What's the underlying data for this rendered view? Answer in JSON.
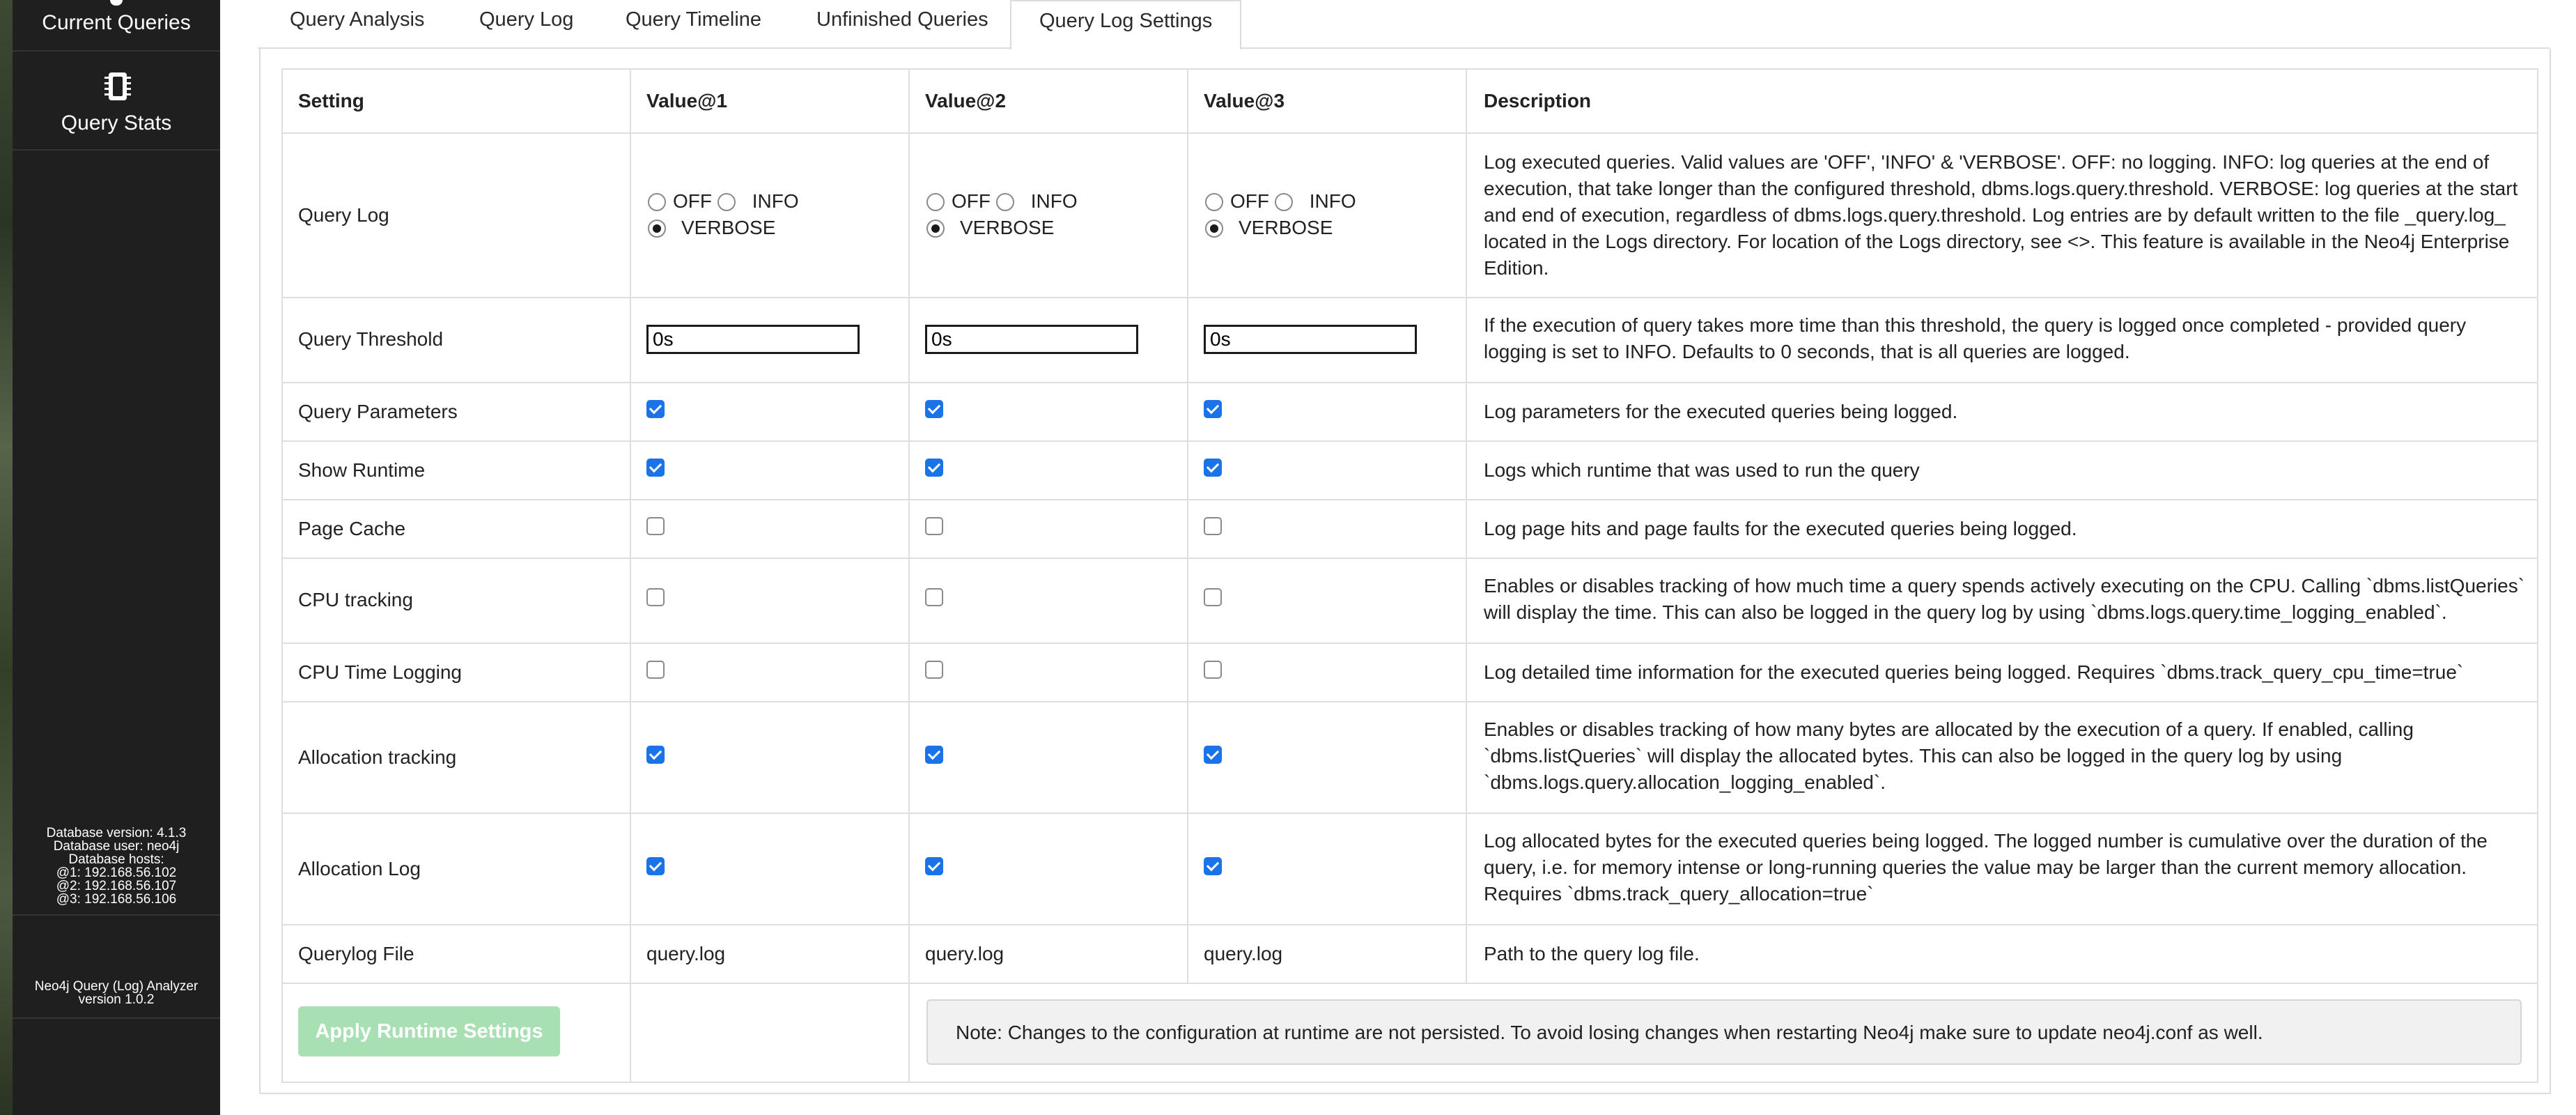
{
  "sidebar": {
    "current_queries": "Current Queries",
    "query_stats": "Query Stats",
    "db_info": [
      "Database version: 4.1.3",
      "Database user: neo4j",
      "Database hosts:",
      "@1: 192.168.56.102",
      "@2: 192.168.56.107",
      "@3: 192.168.56.106"
    ],
    "app_name": "Neo4j Query (Log) Analyzer",
    "app_version": "version 1.0.2"
  },
  "tabs": [
    {
      "label": "Query Analysis",
      "active": false
    },
    {
      "label": "Query Log",
      "active": false
    },
    {
      "label": "Query Timeline",
      "active": false
    },
    {
      "label": "Unfinished Queries",
      "active": false
    },
    {
      "label": "Query Log Settings",
      "active": true
    }
  ],
  "table": {
    "headers": [
      "Setting",
      "Value@1",
      "Value@2",
      "Value@3",
      "Description"
    ],
    "radio_options": [
      "OFF",
      "INFO",
      "VERBOSE"
    ],
    "rows": [
      {
        "setting": "Query Log",
        "type": "radio",
        "values": [
          "VERBOSE",
          "VERBOSE",
          "VERBOSE"
        ],
        "description": "Log executed queries. Valid values are 'OFF', 'INFO' & 'VERBOSE'. OFF: no logging. INFO: log queries at the end of execution, that take longer than the configured threshold, dbms.logs.query.threshold. VERBOSE: log queries at the start and end of execution, regardless of dbms.logs.query.threshold. Log entries are by default written to the file _query.log_ located in the Logs directory. For location of the Logs directory, see <>. This feature is available in the Neo4j Enterprise Edition."
      },
      {
        "setting": "Query Threshold",
        "type": "text",
        "values": [
          "0s",
          "0s",
          "0s"
        ],
        "description": "If the execution of query takes more time than this threshold, the query is logged once completed - provided query logging is set to INFO. Defaults to 0 seconds, that is all queries are logged."
      },
      {
        "setting": "Query Parameters",
        "type": "checkbox",
        "values": [
          true,
          true,
          true
        ],
        "description": "Log parameters for the executed queries being logged."
      },
      {
        "setting": "Show Runtime",
        "type": "checkbox",
        "values": [
          true,
          true,
          true
        ],
        "description": "Logs which runtime that was used to run the query"
      },
      {
        "setting": "Page Cache",
        "type": "checkbox",
        "values": [
          false,
          false,
          false
        ],
        "description": "Log page hits and page faults for the executed queries being logged."
      },
      {
        "setting": "CPU tracking",
        "type": "checkbox",
        "values": [
          false,
          false,
          false
        ],
        "description": "Enables or disables tracking of how much time a query spends actively executing on the CPU. Calling `dbms.listQueries` will display the time. This can also be logged in the query log by using `dbms.logs.query.time_logging_enabled`."
      },
      {
        "setting": "CPU Time Logging",
        "type": "checkbox",
        "values": [
          false,
          false,
          false
        ],
        "description": "Log detailed time information for the executed queries being logged. Requires `dbms.track_query_cpu_time=true`"
      },
      {
        "setting": "Allocation tracking",
        "type": "checkbox",
        "values": [
          true,
          true,
          true
        ],
        "description": "Enables or disables tracking of how many bytes are allocated by the execution of a query. If enabled, calling `dbms.listQueries` will display the allocated bytes. This can also be logged in the query log by using `dbms.logs.query.allocation_logging_enabled`."
      },
      {
        "setting": "Allocation Log",
        "type": "checkbox",
        "values": [
          true,
          true,
          true
        ],
        "description": "Log allocated bytes for the executed queries being logged. The logged number is cumulative over the duration of the query, i.e. for memory intense or long-running queries the value may be larger than the current memory allocation. Requires `dbms.track_query_allocation=true`"
      },
      {
        "setting": "Querylog File",
        "type": "static",
        "values": [
          "query.log",
          "query.log",
          "query.log"
        ],
        "description": "Path to the query log file."
      }
    ]
  },
  "apply_button": "Apply Runtime Settings",
  "note": "Note: Changes to the configuration at runtime are not persisted. To avoid losing changes when restarting Neo4j make sure to update neo4j.conf as well.",
  "colors": {
    "sidebar_bg": "#1f1f1f",
    "checkbox_checked": "#1a73e8",
    "apply_button_bg": "#a8e0b4",
    "note_bg": "#f1f1f1",
    "border": "#dedede"
  }
}
